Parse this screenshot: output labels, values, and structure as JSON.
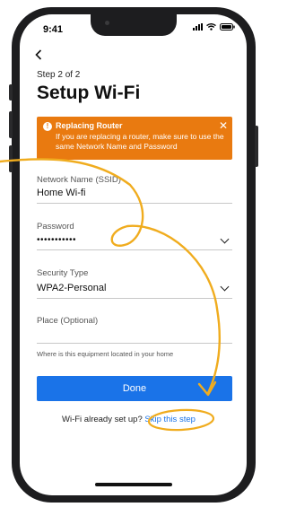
{
  "status_bar": {
    "time": "9:41"
  },
  "header": {
    "back_icon": "chevron-left-icon",
    "step": "Step 2 of 2",
    "title": "Setup Wi-Fi"
  },
  "alert": {
    "icon": "exclamation-icon",
    "title": "Replacing Router",
    "body": "If you are replacing a router, make sure to use the same Network Name and Password",
    "close_icon": "close-icon",
    "color": "#e97a10"
  },
  "form": {
    "ssid": {
      "label": "Network Name (SSID)",
      "value": "Home Wi-fi"
    },
    "password": {
      "label": "Password",
      "value": "•••••••••••",
      "toggle_icon": "chevron-down-icon"
    },
    "security": {
      "label": "Security Type",
      "value": "WPA2-Personal",
      "dropdown_icon": "chevron-down-icon"
    },
    "place": {
      "label": "Place (Optional)",
      "helper": "Where is this equipment located in your home"
    }
  },
  "done_button": {
    "label": "Done",
    "color": "#1a73e8"
  },
  "footer": {
    "prompt": "Wi-Fi already set up?",
    "link": "Skip this step",
    "link_color": "#1a73e8"
  },
  "annotation_color": "#f0ac1e"
}
